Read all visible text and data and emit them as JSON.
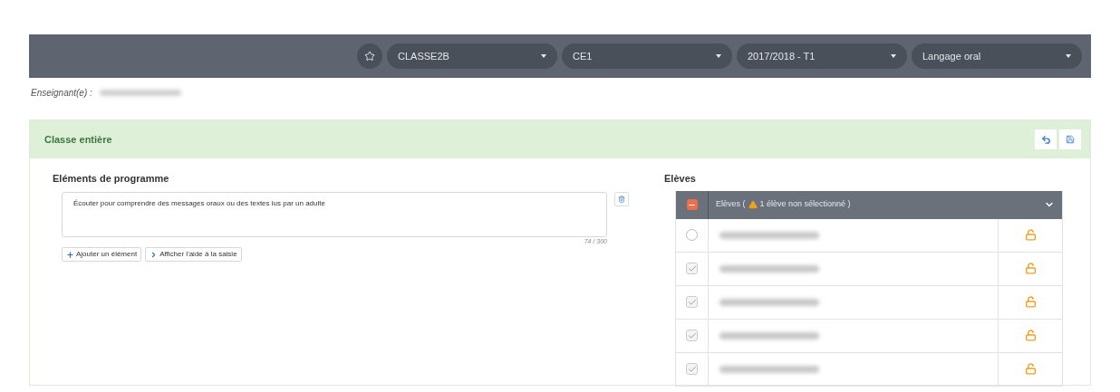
{
  "toolbar": {
    "selects": [
      {
        "value": "CLASSE2B"
      },
      {
        "value": "CE1"
      },
      {
        "value": "2017/2018 - T1"
      },
      {
        "value": "Langage oral"
      }
    ]
  },
  "teacher": {
    "label": "Enseignant(e) :"
  },
  "panel": {
    "title": "Classe entière"
  },
  "program": {
    "heading": "Eléments de programme",
    "elements": [
      {
        "value": "Écouter pour comprendre des messages oraux ou des textes lus par un adulte",
        "counter": "74 / 300"
      }
    ],
    "buttons": [
      {
        "kind": "add",
        "label": "Ajouter un élément"
      },
      {
        "kind": "help",
        "label": "Afficher l'aide à la saisie"
      }
    ]
  },
  "students": {
    "heading": "Elèves",
    "header": {
      "label_start": "Elèves (",
      "warning": "1 élève non sélectionné )"
    },
    "rows": [
      {
        "checked": false
      },
      {
        "checked": true
      },
      {
        "checked": true
      },
      {
        "checked": true
      },
      {
        "checked": true
      }
    ]
  }
}
